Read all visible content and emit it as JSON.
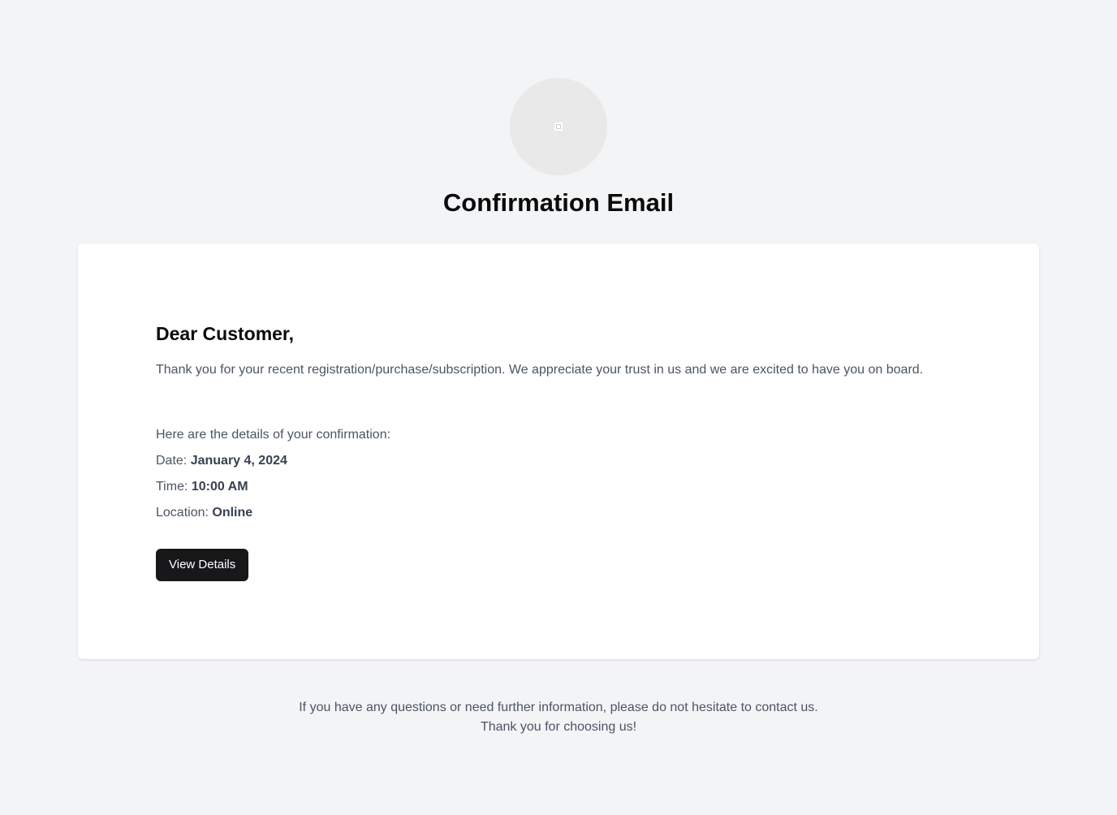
{
  "header": {
    "logo_icon": "placeholder-image-icon",
    "title": "Confirmation Email"
  },
  "card": {
    "greeting": "Dear Customer,",
    "intro": "Thank you for your recent registration/purchase/subscription. We appreciate your trust in us and we are excited to have you on board.",
    "details_intro": "Here are the details of your confirmation:",
    "details": [
      {
        "label": "Date:",
        "value": "January 4, 2024"
      },
      {
        "label": "Time:",
        "value": "10:00 AM"
      },
      {
        "label": "Location:",
        "value": "Online"
      }
    ],
    "button_label": "View Details"
  },
  "footer": {
    "line1": "If you have any questions or need further information, please do not hesitate to contact us.",
    "line2": "Thank you for choosing us!"
  },
  "colors": {
    "background": "#f3f4f6",
    "card": "#ffffff",
    "button": "#18181b",
    "text_muted": "#4b5563",
    "heading": "#0b0b0b"
  }
}
